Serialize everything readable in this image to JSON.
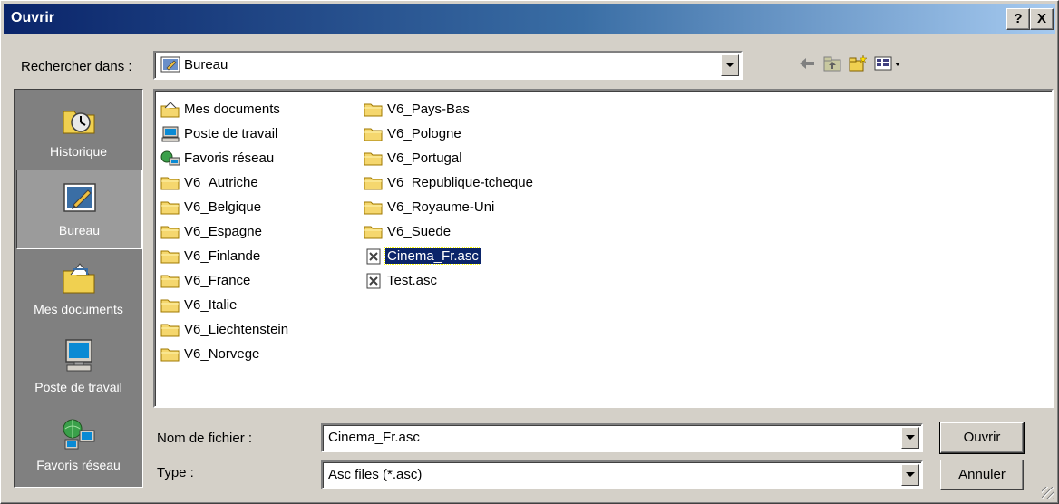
{
  "window": {
    "title": "Ouvrir",
    "help_label": "?",
    "close_label": "X"
  },
  "lookin": {
    "label": "Rechercher dans :",
    "value": "Bureau"
  },
  "places": [
    {
      "label": "Historique"
    },
    {
      "label": "Bureau"
    },
    {
      "label": "Mes documents"
    },
    {
      "label": "Poste de travail"
    },
    {
      "label": "Favoris réseau"
    }
  ],
  "files": {
    "col1": [
      {
        "name": "Mes documents",
        "icon": "mydocs-icon"
      },
      {
        "name": "Poste de travail",
        "icon": "computer-icon"
      },
      {
        "name": "Favoris réseau",
        "icon": "network-icon"
      },
      {
        "name": "V6_Autriche",
        "icon": "folder-icon"
      },
      {
        "name": "V6_Belgique",
        "icon": "folder-icon"
      },
      {
        "name": "V6_Espagne",
        "icon": "folder-icon"
      },
      {
        "name": "V6_Finlande",
        "icon": "folder-icon"
      },
      {
        "name": "V6_France",
        "icon": "folder-icon"
      },
      {
        "name": "V6_Italie",
        "icon": "folder-icon"
      },
      {
        "name": "V6_Liechtenstein",
        "icon": "folder-icon"
      },
      {
        "name": "V6_Norvege",
        "icon": "folder-icon"
      }
    ],
    "col2": [
      {
        "name": "V6_Pays-Bas",
        "icon": "folder-icon"
      },
      {
        "name": "V6_Pologne",
        "icon": "folder-icon"
      },
      {
        "name": "V6_Portugal",
        "icon": "folder-icon"
      },
      {
        "name": "V6_Republique-tcheque",
        "icon": "folder-icon"
      },
      {
        "name": "V6_Royaume-Uni",
        "icon": "folder-icon"
      },
      {
        "name": "V6_Suede",
        "icon": "folder-icon"
      },
      {
        "name": "Cinema_Fr.asc",
        "icon": "asc-file-icon",
        "selected": true
      },
      {
        "name": "Test.asc",
        "icon": "asc-file-icon"
      }
    ]
  },
  "filename": {
    "label": "Nom de fichier :",
    "value": "Cinema_Fr.asc"
  },
  "filetype": {
    "label": "Type :",
    "value": "Asc files (*.asc)"
  },
  "buttons": {
    "open": "Ouvrir",
    "cancel": "Annuler"
  },
  "colors": {
    "titlebar_start": "#0a246a",
    "face": "#d4d0c8",
    "places_bg": "#808080",
    "selection": "#0a246a"
  }
}
